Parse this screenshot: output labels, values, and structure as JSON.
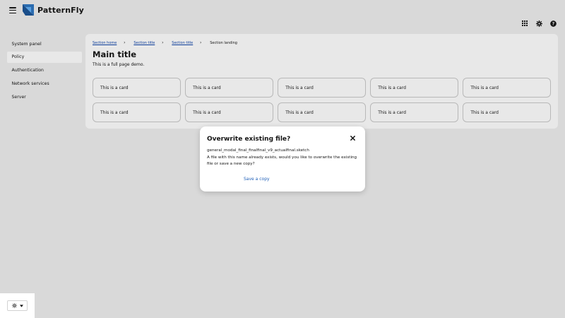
{
  "header": {
    "brand": "PatternFly",
    "icons": [
      "menu-icon",
      "grid-icon",
      "gear-icon",
      "help-icon"
    ]
  },
  "sidebar": {
    "items": [
      {
        "label": "System panel",
        "active": false
      },
      {
        "label": "Policy",
        "active": true
      },
      {
        "label": "Authentication",
        "active": false
      },
      {
        "label": "Network services",
        "active": false
      },
      {
        "label": "Server",
        "active": false
      }
    ]
  },
  "main": {
    "breadcrumb": [
      "Section home",
      "Section title",
      "Section title",
      "Section landing"
    ],
    "title": "Main title",
    "description": "This is a full page demo.",
    "cards": [
      "This is a card",
      "This is a card",
      "This is a card",
      "This is a card",
      "This is a card",
      "This is a card",
      "This is a card",
      "This is a card",
      "This is a card",
      "This is a card"
    ]
  },
  "modal": {
    "title": "Overwrite existing file?",
    "filename": "general_modal_final_finalfinal_v9_actualfinal.sketch",
    "body": "A file with this name already exists, would you like to overwrite the existing file or save a new copy?",
    "action": "Save a copy"
  },
  "colors": {
    "backdrop": "#d9d9d9",
    "panel": "#e8e8e8",
    "link": "#1e5fb8",
    "brand_blue": "#2b6cb0"
  }
}
